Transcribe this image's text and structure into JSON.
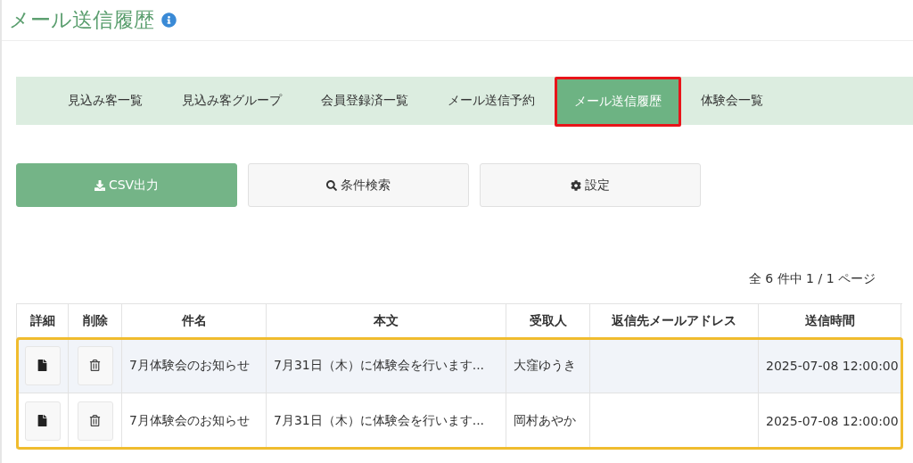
{
  "page_title": "メール送信履歴",
  "tabs": [
    {
      "label": "見込み客一覧",
      "selected": false
    },
    {
      "label": "見込み客グループ",
      "selected": false
    },
    {
      "label": "会員登録済一覧",
      "selected": false
    },
    {
      "label": "メール送信予約",
      "selected": false
    },
    {
      "label": "メール送信履歴",
      "selected": true
    },
    {
      "label": "体験会一覧",
      "selected": false
    }
  ],
  "buttons": [
    {
      "kind": "csv",
      "label": "CSV出力"
    },
    {
      "kind": "search",
      "label": "条件検索"
    },
    {
      "kind": "settings",
      "label": "設定"
    }
  ],
  "pagination": "全 6 件中 1 / 1 ページ",
  "table": {
    "highlighted": true,
    "columns": [
      "詳細",
      "削除",
      "件名",
      "本文",
      "受取人",
      "返信先メールアドレス",
      "送信時間"
    ],
    "rows": [
      {
        "subject": "7月体験会のお知らせ",
        "body": "7月31日（木）に体験会を行います...",
        "recipient": "大窪ゆうき",
        "sent_at": "2025-07-08 12:00:00"
      },
      {
        "subject": "7月体験会のお知らせ",
        "body": "7月31日（木）に体験会を行います...",
        "recipient": "岡村あやか",
        "sent_at": "2025-07-08 12:00:00"
      }
    ]
  }
}
